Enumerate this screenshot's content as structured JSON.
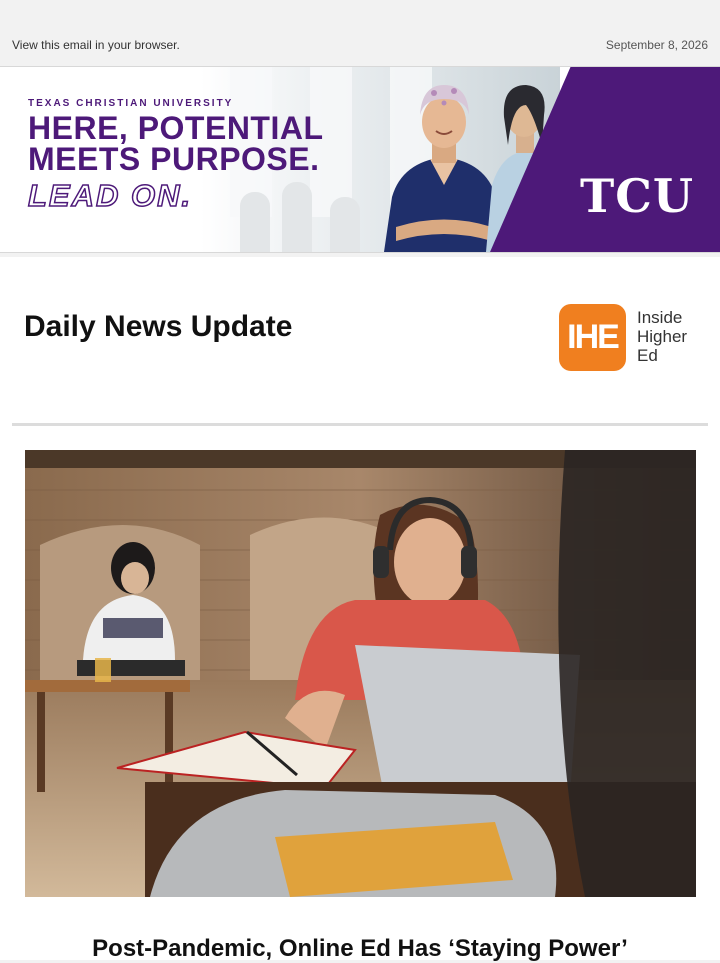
{
  "preheader": {
    "view_link": "View this email in your browser.",
    "date": "September 8, 2026"
  },
  "banner": {
    "eyebrow": "TEXAS CHRISTIAN UNIVERSITY",
    "headline_line1": "HERE, POTENTIAL",
    "headline_line2": "MEETS PURPOSE.",
    "tagline": "LEAD ON.",
    "brand_logo": "TCU",
    "colors": {
      "purple": "#4d1979"
    }
  },
  "newsletter": {
    "title": "Daily News Update",
    "logo_mark": "IHE",
    "logo_wordmark_line1": "Inside",
    "logo_wordmark_line2": "Higher",
    "logo_wordmark_line3": "Ed",
    "colors": {
      "logo_orange": "#f07f1f"
    }
  },
  "article": {
    "headline": "Post-Pandemic, Online Ed Has ‘Staying Power’"
  }
}
